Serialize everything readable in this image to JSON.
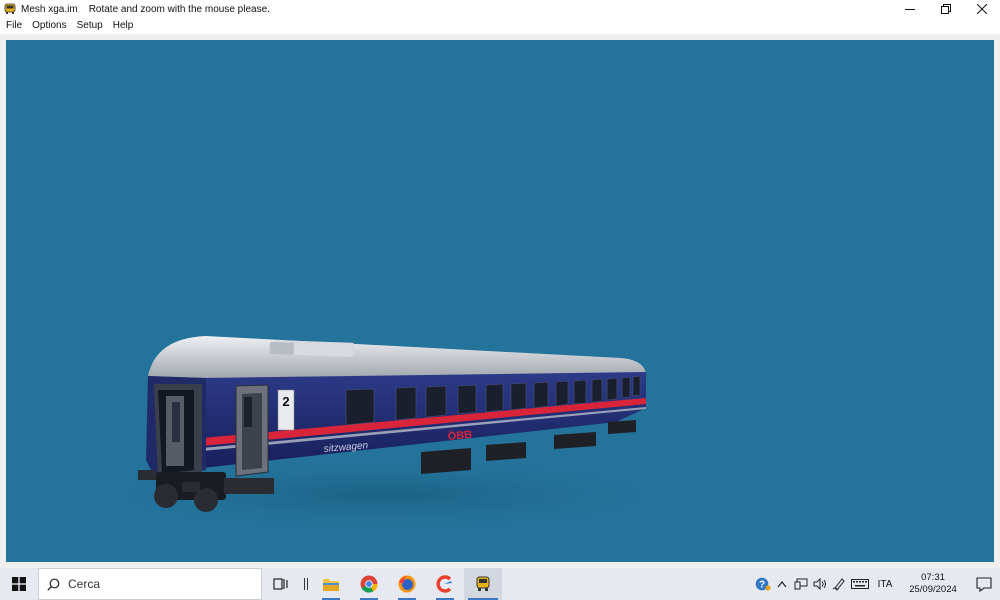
{
  "window": {
    "app_name": "Mesh xga.im",
    "hint": "Rotate and zoom with the mouse please.",
    "viewport_color": "#23739a"
  },
  "menu": [
    {
      "label": "File"
    },
    {
      "label": "Options"
    },
    {
      "label": "Setup"
    },
    {
      "label": "Help"
    }
  ],
  "scene": {
    "model": "passenger-coach",
    "class_number": "2",
    "side_text": "sitzwagen",
    "operator": "ÖBB",
    "body_color": "#1f2a6e",
    "roof_color": "#c9ccd2",
    "stripe_color": "#d8253a"
  },
  "taskbar": {
    "search_placeholder": "Cerca",
    "pinned_icons": [
      "task-view-icon",
      "file-explorer-icon",
      "chrome-icon",
      "firefox-icon",
      "ccleaner-icon",
      "mesh-viewer-icon"
    ],
    "language": "ITA",
    "time": "07:31",
    "date": "25/09/2024"
  }
}
